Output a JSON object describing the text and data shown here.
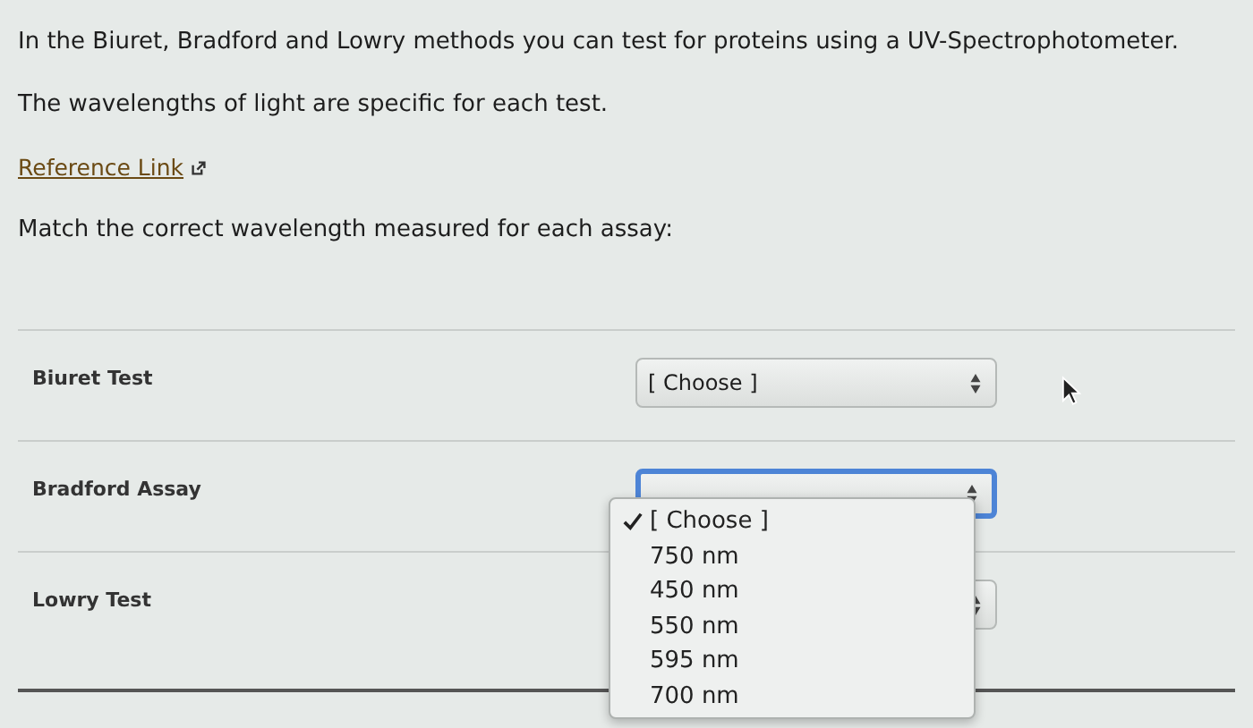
{
  "intro": [
    "In the Biuret, Bradford and Lowry methods you can test for proteins using a UV-Spectrophotometer.",
    "The wavelengths of light are specific for each test."
  ],
  "link": {
    "label": "Reference Link"
  },
  "prompt": "Match the correct wavelength measured for each assay:",
  "matches": [
    {
      "label": "Biuret Test",
      "value": "[ Choose ]",
      "focused": false
    },
    {
      "label": "Bradford Assay",
      "focused": true
    },
    {
      "label": "Lowry Test",
      "focused": false
    }
  ],
  "dropdown": {
    "options": [
      {
        "label": "[ Choose ]",
        "selected": true
      },
      {
        "label": "750 nm",
        "selected": false
      },
      {
        "label": "450 nm",
        "selected": false
      },
      {
        "label": "550 nm",
        "selected": false
      },
      {
        "label": "595 nm",
        "selected": false
      },
      {
        "label": "700 nm",
        "selected": false
      }
    ]
  }
}
